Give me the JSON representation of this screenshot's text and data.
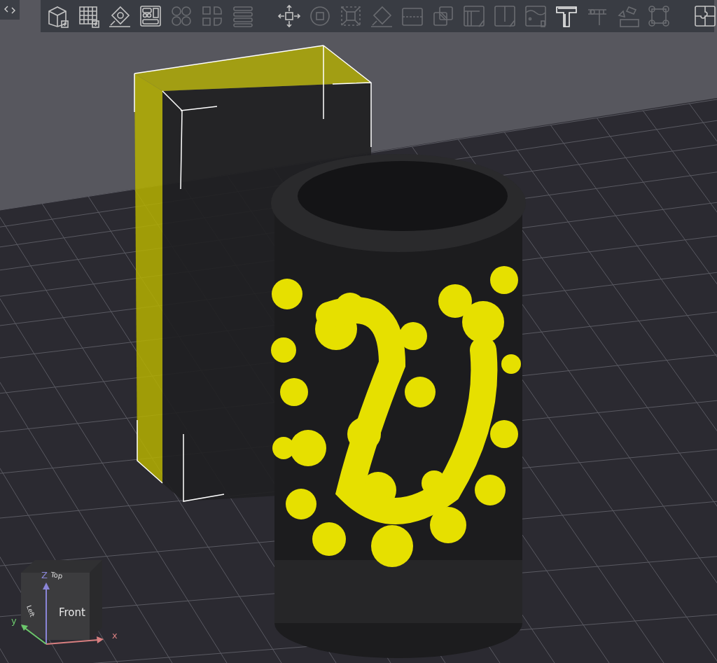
{
  "toolbar": {
    "items": [
      {
        "kind": "box",
        "disabled": false
      },
      {
        "kind": "grid",
        "disabled": false
      },
      {
        "kind": "label",
        "disabled": false
      },
      {
        "kind": "layout",
        "disabled": false
      },
      {
        "kind": "array",
        "disabled": true
      },
      {
        "kind": "mirror",
        "disabled": true
      },
      {
        "kind": "stack",
        "disabled": true
      },
      {
        "kind": "separator"
      },
      {
        "kind": "move",
        "disabled": false
      },
      {
        "kind": "rotate",
        "disabled": true
      },
      {
        "kind": "scale",
        "disabled": true
      },
      {
        "kind": "flatten",
        "disabled": true
      },
      {
        "kind": "split",
        "disabled": true
      },
      {
        "kind": "overlap",
        "disabled": true
      },
      {
        "kind": "brush",
        "disabled": true
      },
      {
        "kind": "texture",
        "disabled": true
      },
      {
        "kind": "relief",
        "disabled": true
      },
      {
        "kind": "text",
        "disabled": false
      },
      {
        "kind": "caliper",
        "disabled": true
      },
      {
        "kind": "drop",
        "disabled": true
      },
      {
        "kind": "corners",
        "disabled": true
      },
      {
        "kind": "separator"
      },
      {
        "kind": "puzzle",
        "disabled": false
      }
    ]
  },
  "view_cube": {
    "top": "Top",
    "left": "Left",
    "front": "Front",
    "z_axis": "Z",
    "y_axis": "y",
    "x_axis": "x"
  }
}
